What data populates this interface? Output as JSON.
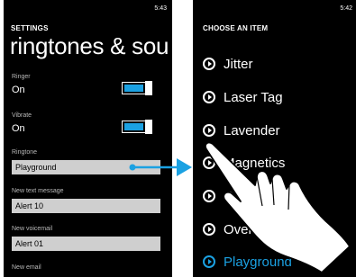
{
  "left_screen": {
    "time": "5:43",
    "section": "SETTINGS",
    "title": "ringtones & sou",
    "ringer": {
      "label": "Ringer",
      "value": "On",
      "on": true
    },
    "vibrate": {
      "label": "Vibrate",
      "value": "On",
      "on": true
    },
    "ringtone": {
      "label": "Ringtone",
      "value": "Playground"
    },
    "new_text": {
      "label": "New text message",
      "value": "Alert 10"
    },
    "new_voicemail": {
      "label": "New voicemail",
      "value": "Alert 01"
    },
    "new_email": {
      "label": "New email"
    }
  },
  "right_screen": {
    "time": "5:42",
    "title": "CHOOSE AN ITEM",
    "items": [
      {
        "label": "Jitter"
      },
      {
        "label": "Laser Tag"
      },
      {
        "label": "Lavender"
      },
      {
        "label": "Magnetics"
      },
      {
        "label": "O"
      },
      {
        "label": "Over"
      },
      {
        "label": "Playground",
        "selected": true
      }
    ]
  },
  "colors": {
    "accent": "#1ba1e2",
    "picker_background": "#cfcfcf",
    "screen_background": "#000000"
  },
  "icons": {
    "list_radio": "play-circle-icon",
    "connector": "arrow-right-icon",
    "gesture": "hand-pointer-icon"
  }
}
